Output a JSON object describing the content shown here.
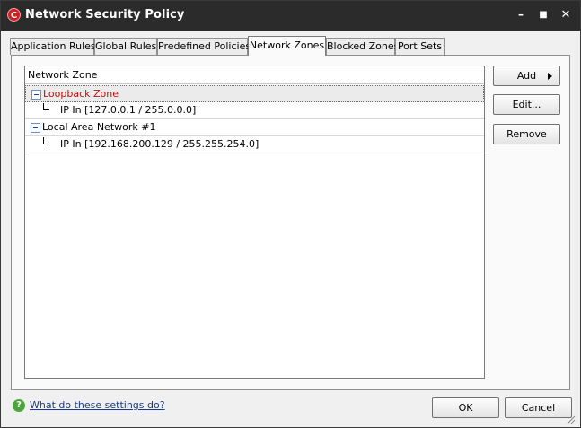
{
  "window": {
    "title": "Network Security Policy",
    "icon_letter": "C",
    "controls": {
      "minimize": "–",
      "maximize": "■",
      "close": "✕"
    }
  },
  "tabs": [
    {
      "label": "Application Rules",
      "active": false
    },
    {
      "label": "Global Rules",
      "active": false
    },
    {
      "label": "Predefined Policies",
      "active": false
    },
    {
      "label": "Network Zones",
      "active": true
    },
    {
      "label": "Blocked Zones",
      "active": false
    },
    {
      "label": "Port Sets",
      "active": false
    }
  ],
  "tree": {
    "header": "Network Zone",
    "zones": [
      {
        "name": "Loopback Zone",
        "selected": true,
        "color": "#c01010",
        "child": "IP In [127.0.0.1 / 255.0.0.0]"
      },
      {
        "name": "Local Area Network #1",
        "selected": false,
        "color": "#000000",
        "child": "IP In [192.168.200.129 / 255.255.254.0]"
      }
    ]
  },
  "side_buttons": {
    "add": "Add",
    "edit": "Edit...",
    "remove": "Remove"
  },
  "footer": {
    "help_icon": "?",
    "help_link": "What do these settings do?",
    "ok": "OK",
    "cancel": "Cancel"
  }
}
